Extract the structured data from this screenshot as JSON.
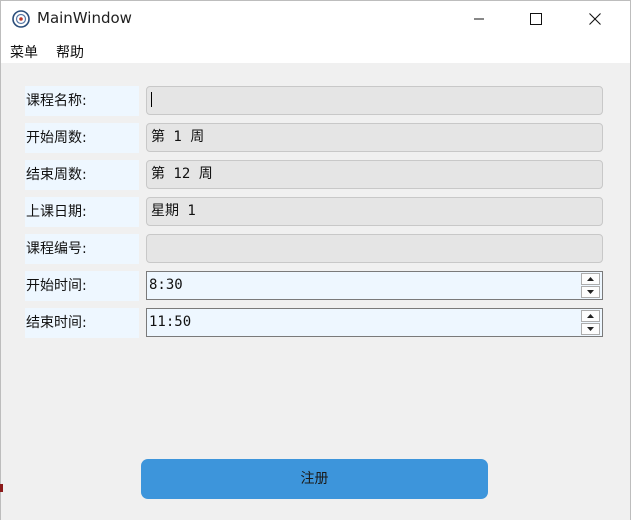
{
  "window": {
    "title": "MainWindow",
    "app_icon": "qt-app-icon",
    "controls": {
      "minimize_icon": "minimize-icon",
      "maximize_icon": "maximize-icon",
      "close_icon": "close-icon"
    }
  },
  "menubar": {
    "items": [
      {
        "label": "菜单"
      },
      {
        "label": "帮助"
      }
    ]
  },
  "form": {
    "rows": [
      {
        "label": "课程名称:",
        "value": "",
        "type": "text",
        "focused": true
      },
      {
        "label": "开始周数:",
        "value": "第 1 周",
        "type": "combo"
      },
      {
        "label": "结束周数:",
        "value": "第 12 周",
        "type": "combo"
      },
      {
        "label": "上课日期:",
        "value": "星期 1",
        "type": "combo"
      },
      {
        "label": "课程编号:",
        "value": "",
        "type": "text"
      },
      {
        "label": "开始时间:",
        "value": "8:30",
        "type": "time"
      },
      {
        "label": "结束时间:",
        "value": "11:50",
        "type": "time"
      }
    ]
  },
  "register_button": {
    "label": "注册"
  },
  "colors": {
    "accent_button": "#3d95db",
    "label_bg": "#eef7ff",
    "field_bg": "#e5e5e5",
    "window_bg": "#f0f0f0"
  }
}
